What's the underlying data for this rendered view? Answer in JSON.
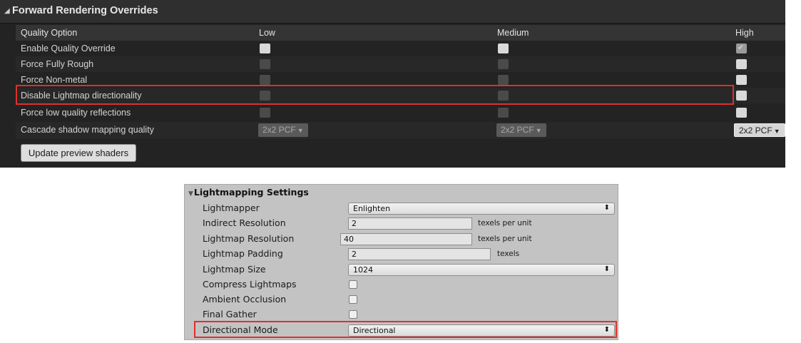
{
  "unreal": {
    "header": {
      "arrow": "◢",
      "title": "Forward Rendering Overrides"
    },
    "columns": {
      "option": "Quality Option",
      "low": "Low",
      "medium": "Medium",
      "high": "High"
    },
    "rows": [
      {
        "label": "Enable Quality Override"
      },
      {
        "label": "Force Fully Rough"
      },
      {
        "label": "Force Non-metal"
      },
      {
        "label": "Disable Lightmap directionality"
      },
      {
        "label": "Force low quality reflections"
      },
      {
        "label": "Cascade shadow mapping quality",
        "low": "2x2 PCF",
        "medium": "2x2 PCF",
        "high": "2x2 PCF"
      }
    ],
    "button": "Update preview shaders",
    "colors": {
      "highlight": "#e0302a",
      "panel": "#232323"
    }
  },
  "unity": {
    "title": "Lightmapping Settings",
    "title_icon": "triangle-down-icon",
    "rows": [
      {
        "label": "Lightmapper",
        "value": "Enlighten"
      },
      {
        "label": "Indirect Resolution",
        "value": "2",
        "unit": "texels per unit"
      },
      {
        "label": "Lightmap Resolution",
        "value": "40",
        "unit": "texels per unit"
      },
      {
        "label": "Lightmap Padding",
        "value": "2",
        "unit": "texels"
      },
      {
        "label": "Lightmap Size",
        "value": "1024"
      },
      {
        "label": "Compress Lightmaps",
        "checked": false
      },
      {
        "label": "Ambient Occlusion",
        "checked": false
      },
      {
        "label": "Final Gather",
        "checked": false
      },
      {
        "label": "Directional Mode",
        "value": "Directional"
      }
    ],
    "select_arrow": "⬍",
    "colors": {
      "panel": "#c3c3c3",
      "highlight": "#e0302a"
    }
  }
}
